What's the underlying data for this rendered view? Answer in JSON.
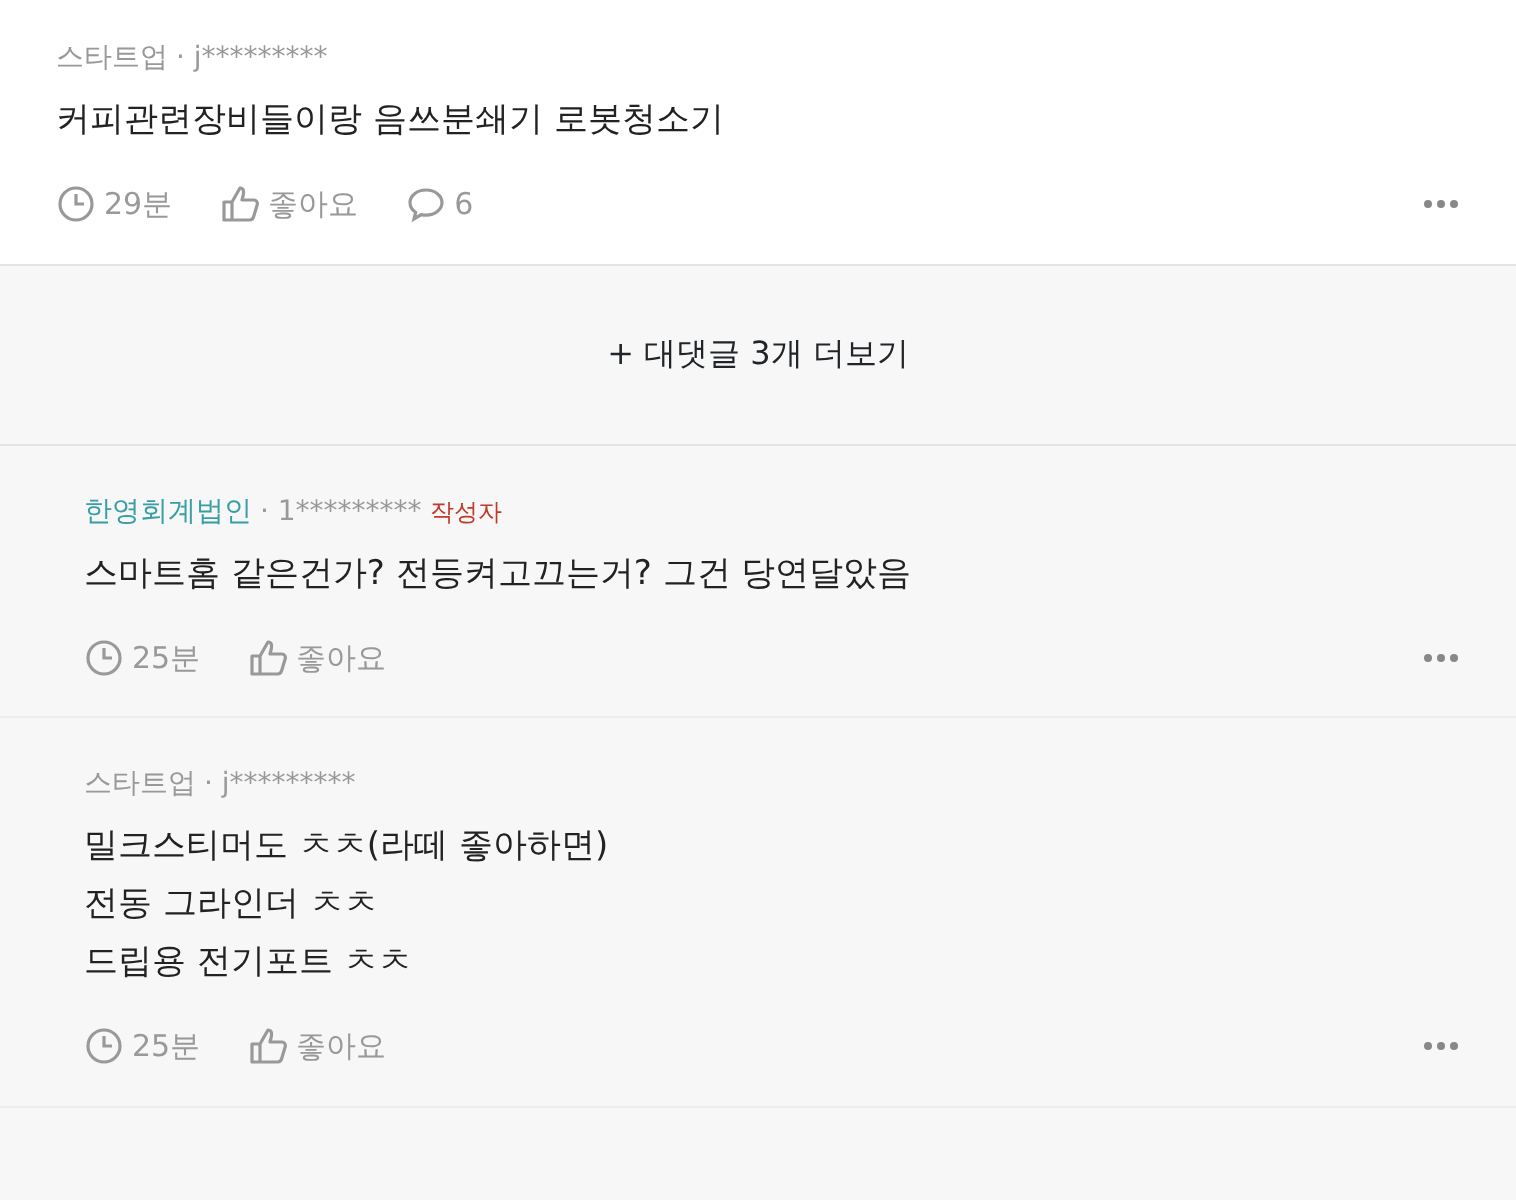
{
  "comments": [
    {
      "kind": "top",
      "company": "스타트업",
      "company_link": false,
      "user": "· j*********",
      "lines": [
        "커피관련장비들이랑 음쓰분쇄기 로봇청소기"
      ],
      "time": "29분",
      "like": "좋아요",
      "replies": "6"
    },
    {
      "kind": "more",
      "label": "+ 대댓글 3개 더보기"
    },
    {
      "kind": "reply",
      "company": "한영회계법인",
      "company_link": true,
      "user": "· 1*********",
      "author_badge": "작성자",
      "lines": [
        "스마트홈 같은건가? 전등켜고끄는거? 그건 당연달았음"
      ],
      "time": "25분",
      "like": "좋아요"
    },
    {
      "kind": "reply",
      "company": "스타트업",
      "company_link": false,
      "user": "· j*********",
      "lines": [
        "밀크스티머도 ㅊㅊ(라떼 좋아하면)",
        "전동 그라인더 ㅊㅊ",
        "드립용 전기포트 ㅊㅊ"
      ],
      "time": "25분",
      "like": "좋아요"
    }
  ]
}
